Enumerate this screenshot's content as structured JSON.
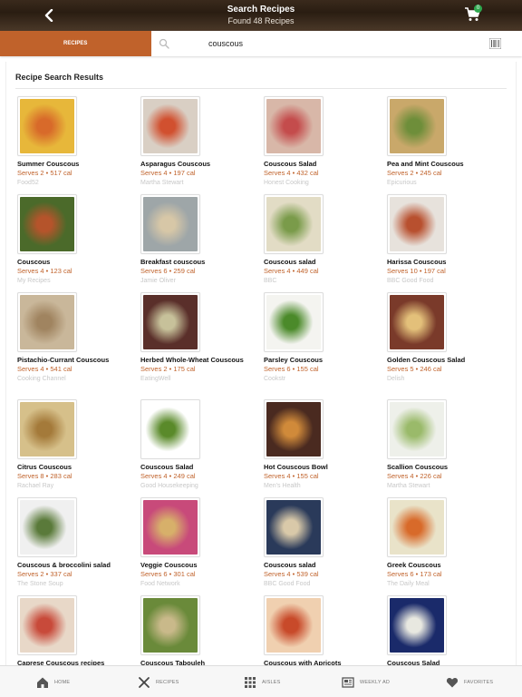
{
  "header": {
    "title": "Search Recipes",
    "subtitle": "Found 48 Recipes",
    "cart_count": "0"
  },
  "search": {
    "tab_label": "RECIPES",
    "query": "couscous"
  },
  "results": {
    "title": "Recipe Search Results",
    "items": [
      {
        "name": "Summer Couscous",
        "meta": "Serves 2 • 517 cal",
        "source": "Food52",
        "colors": [
          "#e7b73a",
          "#d86a2a"
        ]
      },
      {
        "name": "Asparagus Couscous",
        "meta": "Serves 4 • 197 cal",
        "source": "Martha Stewart",
        "colors": [
          "#d9cfc4",
          "#d1502f"
        ]
      },
      {
        "name": "Couscous Salad",
        "meta": "Serves 4 • 432 cal",
        "source": "Honest Cooking",
        "colors": [
          "#d8b7a8",
          "#c44c4c"
        ]
      },
      {
        "name": "Pea and Mint Couscous",
        "meta": "Serves 2 • 245 cal",
        "source": "Epicurious",
        "colors": [
          "#c9a86a",
          "#6e8e3a"
        ]
      },
      {
        "name": "Couscous",
        "meta": "Serves 4 • 123 cal",
        "source": "My Recipes",
        "colors": [
          "#4b6a2a",
          "#b5542b"
        ]
      },
      {
        "name": "Breakfast couscous",
        "meta": "Serves 6 • 259 cal",
        "source": "Jamie Oliver",
        "colors": [
          "#9ea6a8",
          "#d7c7a7"
        ]
      },
      {
        "name": "Couscous salad",
        "meta": "Serves 4 • 449 cal",
        "source": "BBC",
        "colors": [
          "#e2dcc5",
          "#7a9b4a"
        ]
      },
      {
        "name": "Harissa Couscous",
        "meta": "Serves 10 • 197 cal",
        "source": "BBC Good Food",
        "colors": [
          "#e7e2dc",
          "#b8502f"
        ]
      },
      {
        "name": "Pistachio-Currant Couscous",
        "meta": "Serves 4 • 541 cal",
        "source": "Cooking Channel",
        "colors": [
          "#c9b79a",
          "#a08460"
        ]
      },
      {
        "name": "Herbed Whole-Wheat Couscous",
        "meta": "Serves 2 • 175 cal",
        "source": "EatingWell",
        "colors": [
          "#5a2f2a",
          "#c7c19a"
        ]
      },
      {
        "name": "Parsley Couscous",
        "meta": "Serves 6 • 155 cal",
        "source": "Cookstr",
        "colors": [
          "#f4f4f0",
          "#4b8a2a"
        ]
      },
      {
        "name": "Golden Couscous Salad",
        "meta": "Serves 5 • 246 cal",
        "source": "Delish",
        "colors": [
          "#7a3a2a",
          "#e3c07a"
        ]
      },
      {
        "name": "Citrus Couscous",
        "meta": "Serves 8 • 283 cal",
        "source": "Rachael Ray",
        "colors": [
          "#d6c08a",
          "#a47a3a"
        ]
      },
      {
        "name": "Couscous Salad",
        "meta": "Serves 4 • 249 cal",
        "source": "Good Housekeeping",
        "colors": [
          "#ffffff",
          "#5a8a2a"
        ]
      },
      {
        "name": "Hot Couscous Bowl",
        "meta": "Serves 4 • 155 cal",
        "source": "Men's Health",
        "colors": [
          "#4a2a20",
          "#d08a3a"
        ]
      },
      {
        "name": "Scallion Couscous",
        "meta": "Serves 4 • 226 cal",
        "source": "Martha Stewart",
        "colors": [
          "#eef0ea",
          "#9aba6a"
        ]
      },
      {
        "name": "Couscous & broccolini salad",
        "meta": "Serves 2 • 337 cal",
        "source": "The Stone Soup",
        "colors": [
          "#f0f0f0",
          "#5a7a3a"
        ]
      },
      {
        "name": "Veggie Couscous",
        "meta": "Serves 6 • 301 cal",
        "source": "Food Network",
        "colors": [
          "#c84a7a",
          "#d7b06a"
        ]
      },
      {
        "name": "Couscous salad",
        "meta": "Serves 4 • 539 cal",
        "source": "BBC Good Food",
        "colors": [
          "#2a3a5a",
          "#d9c9a9"
        ]
      },
      {
        "name": "Greek Couscous",
        "meta": "Serves 6 • 173 cal",
        "source": "The Daily Meal",
        "colors": [
          "#e9e3c9",
          "#d86a2a"
        ]
      },
      {
        "name": "Caprese Couscous recipes",
        "meta": "",
        "source": "",
        "colors": [
          "#e8d8c8",
          "#c84a3a"
        ]
      },
      {
        "name": "Couscous Tabouleh",
        "meta": "",
        "source": "",
        "colors": [
          "#6a8a3a",
          "#c9b98a"
        ]
      },
      {
        "name": "Couscous with Apricots",
        "meta": "",
        "source": "",
        "colors": [
          "#f0d0b0",
          "#c84a2a"
        ]
      },
      {
        "name": "Couscous Salad",
        "meta": "",
        "source": "",
        "colors": [
          "#1a2a6a",
          "#e8e8e0"
        ]
      }
    ]
  },
  "nav": {
    "home": "HOME",
    "recipes": "RECIPES",
    "aisles": "AISLES",
    "weekly_ad": "WEEKLY AD",
    "favorites": "FAVORITES"
  },
  "colors": {
    "accent": "#c0622b",
    "source_text": "#c8c8c8"
  }
}
